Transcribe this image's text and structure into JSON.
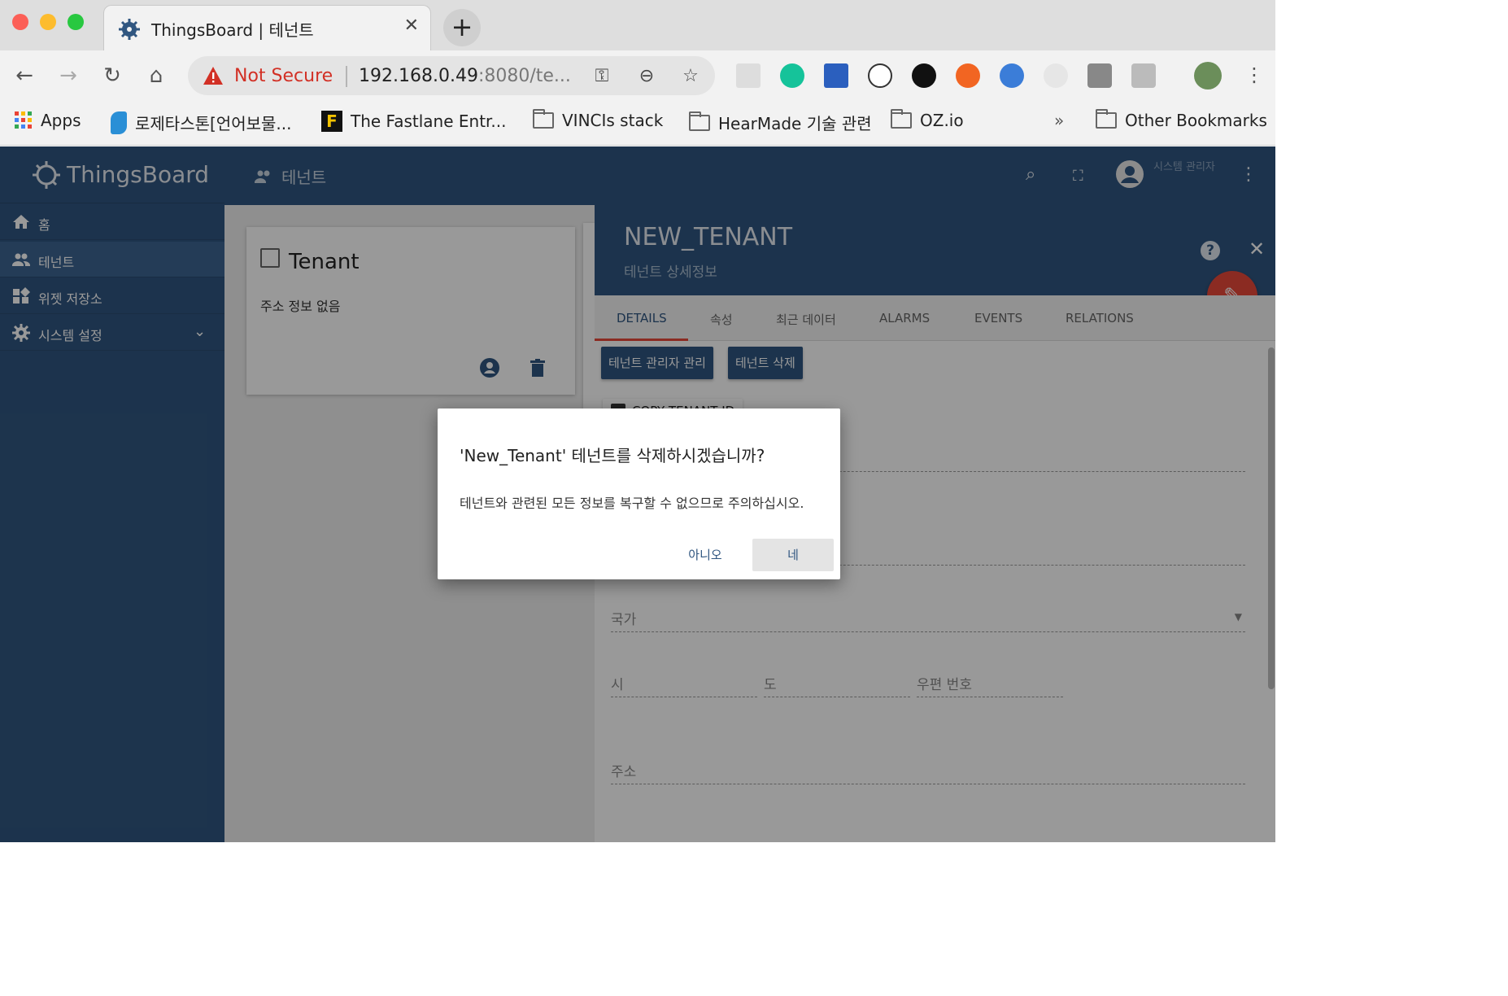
{
  "browser": {
    "tab_title": "ThingsBoard | 테넌트",
    "security_label": "Not Secure",
    "url_host": "192.168.0.49",
    "url_rest": ":8080/te...",
    "bookmarks": [
      "Apps",
      "로제타스톤[언어보물...",
      "The Fastlane Entr...",
      "VINCIs stack",
      "HearMade 기술 관련",
      "OZ.io"
    ],
    "more": "»",
    "other_bookmarks": "Other Bookmarks"
  },
  "app": {
    "logo": "ThingsBoard",
    "breadcrumb": "테넌트",
    "user_role": "시스템 관리자",
    "menu": [
      {
        "label": "홈",
        "icon": "home-icon"
      },
      {
        "label": "테넌트",
        "icon": "people-icon"
      },
      {
        "label": "위젯 저장소",
        "icon": "widgets-icon"
      },
      {
        "label": "시스템 설정",
        "icon": "settings-icon"
      }
    ]
  },
  "card": {
    "title": "Tenant",
    "address": "주소 정보 없음"
  },
  "detail": {
    "name": "NEW_TENANT",
    "subtitle": "테넌트 상세정보",
    "tabs": [
      "DETAILS",
      "속성",
      "최근 데이터",
      "ALARMS",
      "EVENTS",
      "RELATIONS"
    ],
    "manage_admins": "테넌트 관리자 관리",
    "delete_tenant": "테넌트 삭제",
    "copy_id": "COPY TENANT ID",
    "fields": {
      "country": "국가",
      "city": "시",
      "state": "도",
      "zip": "우편 번호",
      "address": "주소"
    }
  },
  "dialog": {
    "title": "'New_Tenant' 테넌트를 삭제하시겠습니까?",
    "message": "테넌트와 관련된 모든 정보를 복구할 수 없으므로 주의하십시오.",
    "no": "아니오",
    "yes": "네"
  },
  "colors": {
    "primary": "#305680",
    "accent": "#e8483a",
    "warning": "#d23025"
  }
}
